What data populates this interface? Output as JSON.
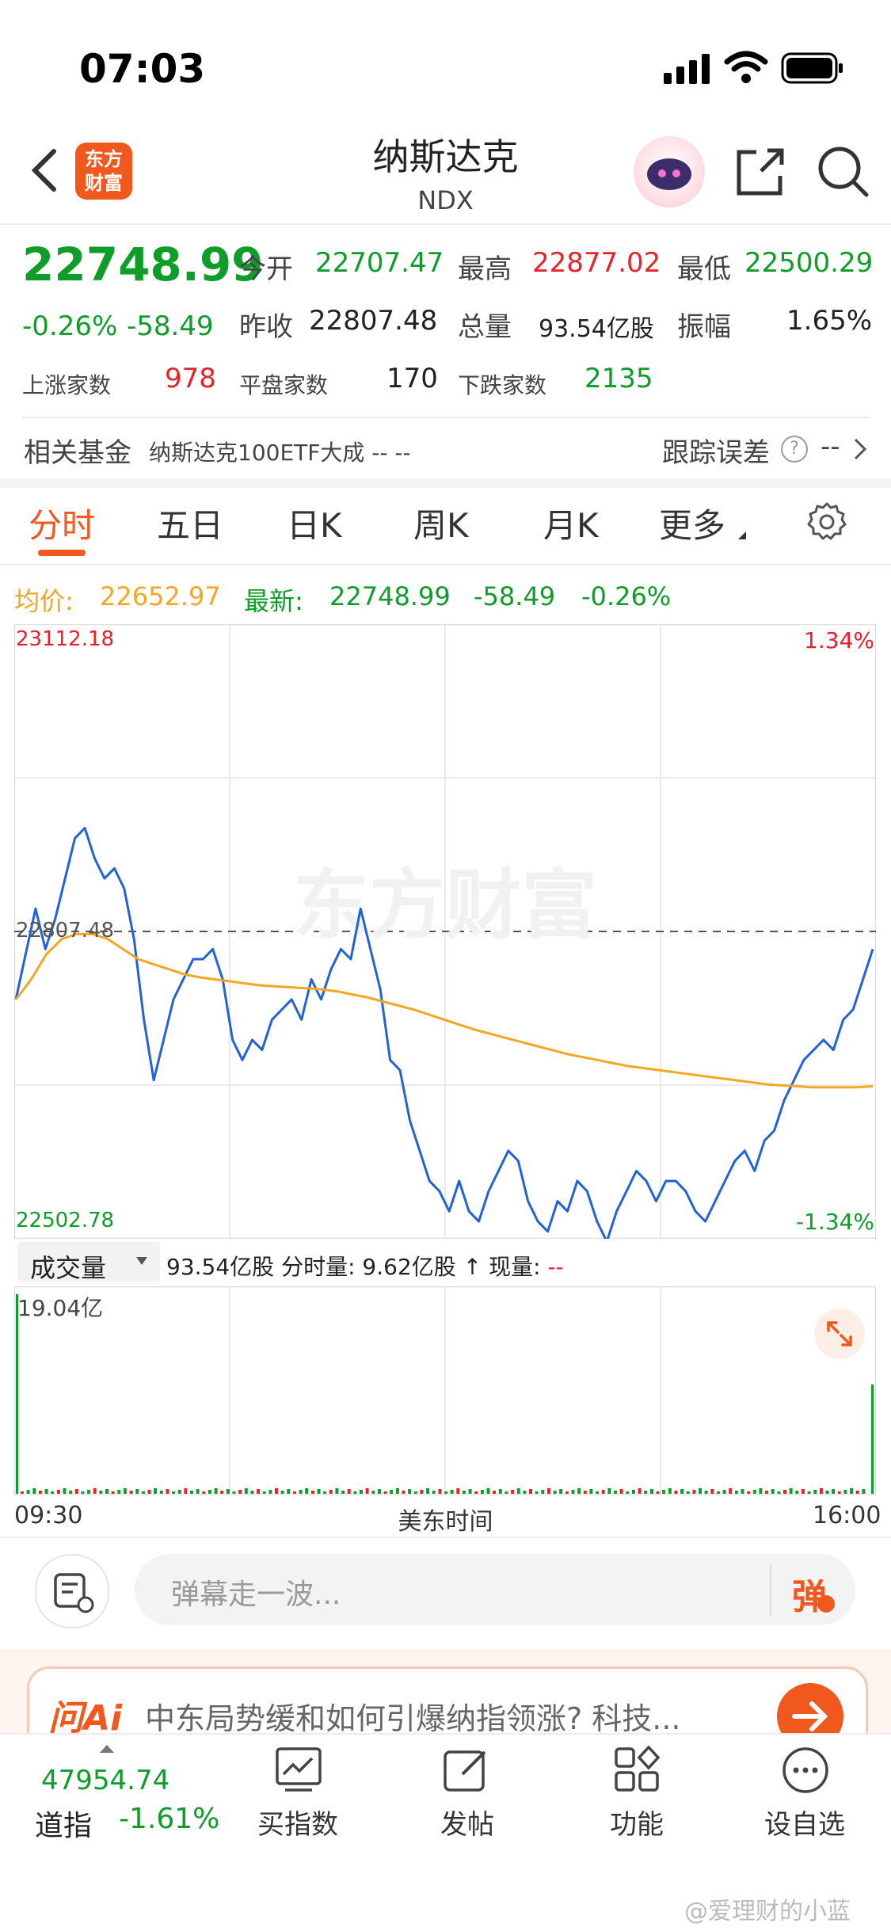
{
  "status_bar": {
    "time": "07:03"
  },
  "nav": {
    "logo_line1": "东方",
    "logo_line2": "财富",
    "title": "纳斯达克",
    "subtitle": "NDX"
  },
  "quote": {
    "price": "22748.99",
    "change_pct": "-0.26%",
    "change": "-58.49",
    "open_label": "今开",
    "open": "22707.47",
    "high_label": "最高",
    "high": "22877.02",
    "low_label": "最低",
    "low": "22500.29",
    "prev_close_label": "昨收",
    "prev_close": "22807.48",
    "volume_label": "总量",
    "volume": "93.54亿股",
    "amplitude_label": "振幅",
    "amplitude": "1.65%",
    "up_label": "上涨家数",
    "up_count": "978",
    "flat_label": "平盘家数",
    "flat_count": "170",
    "down_label": "下跌家数",
    "down_count": "2135"
  },
  "fund": {
    "label": "相关基金",
    "name": "纳斯达克100ETF大成 -- --",
    "tracking_label": "跟踪误差",
    "tracking_value": "--"
  },
  "tabs": [
    "分时",
    "五日",
    "日K",
    "周K",
    "月K",
    "更多"
  ],
  "chart_header": {
    "avg_label": "均价:",
    "avg_value": "22652.97",
    "last_label": "最新:",
    "last_value": "22748.99",
    "change": "-58.49",
    "change_pct": "-0.26%"
  },
  "chart_data": {
    "type": "line",
    "y_max_label": "23112.18",
    "y_min_label": "22502.78",
    "ref_label": "22807.48",
    "pct_max_label": "1.34%",
    "pct_min_label": "-1.34%",
    "ylim": [
      22502.78,
      23112.18
    ],
    "reference": 22807.48,
    "x_start": "09:30",
    "x_end": "16:00",
    "x_label": "美东时间",
    "watermark": "东方财富",
    "series": [
      {
        "name": "",
        "color": "#2262d8",
        "values": [
          22740,
          22785,
          22830,
          22790,
          22820,
          22860,
          22900,
          22910,
          22880,
          22860,
          22870,
          22850,
          22800,
          22720,
          22660,
          22700,
          22740,
          22760,
          22780,
          22780,
          22790,
          22760,
          22700,
          22680,
          22700,
          22690,
          22720,
          22730,
          22740,
          22720,
          22760,
          22740,
          22770,
          22790,
          22780,
          22830,
          22790,
          22750,
          22680,
          22670,
          22620,
          22590,
          22560,
          22550,
          22530,
          22560,
          22530,
          22520,
          22550,
          22570,
          22590,
          22580,
          22540,
          22520,
          22510,
          22540,
          22530,
          22560,
          22550,
          22520,
          22500,
          22530,
          22550,
          22570,
          22560,
          22540,
          22560,
          22560,
          22550,
          22530,
          22520,
          22540,
          22560,
          22580,
          22590,
          22570,
          22600,
          22610,
          22640,
          22660,
          22680,
          22690,
          22700,
          22690,
          22720,
          22730,
          22760,
          22790
        ]
      },
      {
        "name": "",
        "color": "#f5a623",
        "values": [
          22740,
          22760,
          22785,
          22800,
          22805,
          22805,
          22800,
          22790,
          22780,
          22775,
          22770,
          22765,
          22762,
          22760,
          22758,
          22756,
          22754,
          22753,
          22752,
          22751,
          22750,
          22748,
          22745,
          22742,
          22738,
          22734,
          22730,
          22725,
          22720,
          22715,
          22710,
          22706,
          22702,
          22698,
          22694,
          22690,
          22686,
          22683,
          22680,
          22677,
          22674,
          22672,
          22670,
          22668,
          22666,
          22664,
          22662,
          22660,
          22658,
          22656,
          22655,
          22654,
          22653,
          22653,
          22653,
          22653,
          22654
        ]
      }
    ]
  },
  "volume_bar": {
    "dropdown": "成交量",
    "total": "93.54亿股",
    "period_label": "分时量:",
    "period_value": "9.62亿股",
    "arrow": "↑",
    "now_label": "现量:",
    "now_value": "--",
    "max_label": "19.04亿"
  },
  "comment": {
    "placeholder": "弹幕走一波...",
    "send": "弹"
  },
  "ai_banner": {
    "brand": "问Ai",
    "text": "中东局势缓和如何引爆纳指领涨? 科技..."
  },
  "bottom": {
    "index_value": "47954.74",
    "index_name": "道指",
    "index_change": "-1.61%",
    "items": [
      "买指数",
      "发帖",
      "功能",
      "设自选"
    ]
  },
  "watermark_user": "@爱理财的小蓝",
  "colors": {
    "up": "#e8212c",
    "down": "#0f9d2a",
    "accent": "#f0581d",
    "price_line": "#2262d8",
    "avg_line": "#f5a623"
  }
}
